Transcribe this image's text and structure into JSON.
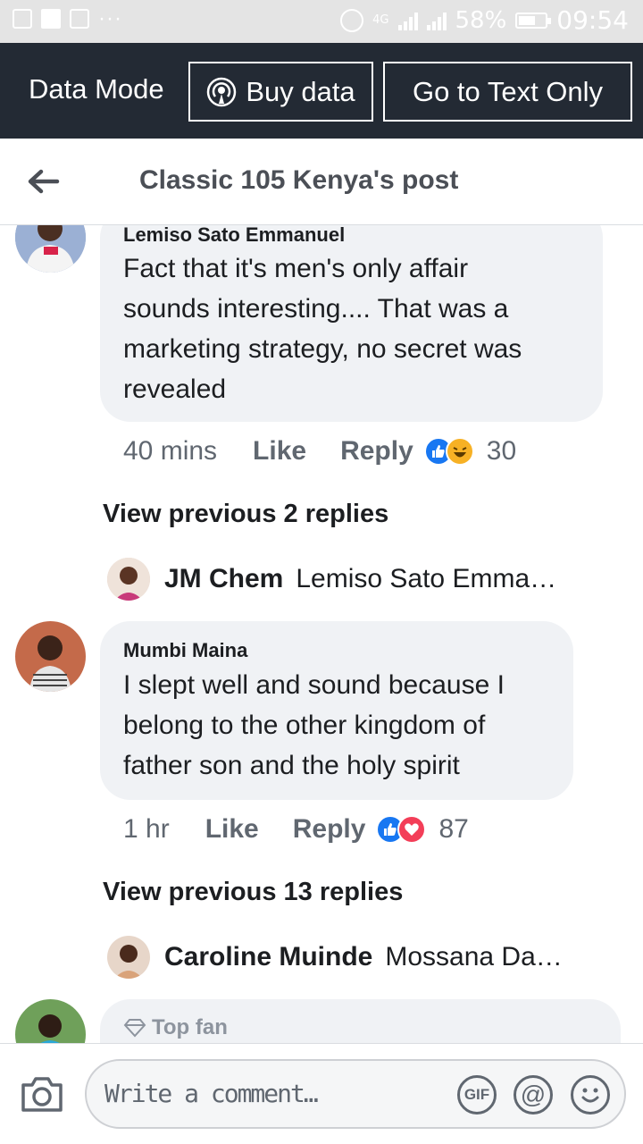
{
  "status_bar": {
    "network": "4G",
    "battery": "58%",
    "time": "09:54"
  },
  "data_bar": {
    "mode_label": "Data Mode",
    "buy_label": "Buy data",
    "text_only_label": "Go to Text Only"
  },
  "header": {
    "title": "Classic 105 Kenya's post"
  },
  "comments": [
    {
      "author": "Lemiso Sato Emmanuel",
      "lines": [
        "Fact that it's men's only affair",
        "sounds interesting.... That was a",
        "marketing strategy, no secret was",
        "revealed"
      ],
      "time": "40 mins",
      "like": "Like",
      "reply": "Reply",
      "reactions": [
        "like",
        "haha"
      ],
      "reaction_count": "30",
      "view_previous": "View previous 2 replies",
      "latest_reply": {
        "author": "JM Chem",
        "text": "Lemiso Sato Emma…"
      }
    },
    {
      "author": "Mumbi Maina",
      "lines": [
        "I slept well and sound because I",
        "belong to the other kingdom of",
        "father son and the holy spirit"
      ],
      "time": "1 hr",
      "like": "Like",
      "reply": "Reply",
      "reactions": [
        "like",
        "love"
      ],
      "reaction_count": "87",
      "view_previous": "View previous 13 replies",
      "latest_reply": {
        "author": "Caroline Muinde",
        "text": "Mossana Da…"
      }
    },
    {
      "badge": "Top fan"
    }
  ],
  "composer": {
    "placeholder": "Write a comment…",
    "gif_label": "GIF",
    "at_label": "@"
  },
  "colors": {
    "data_bar_bg": "#232a34",
    "bubble_bg": "#f0f2f5",
    "like_blue": "#1877f2",
    "love_red": "#f33e58",
    "haha_yellow": "#f7b125"
  }
}
